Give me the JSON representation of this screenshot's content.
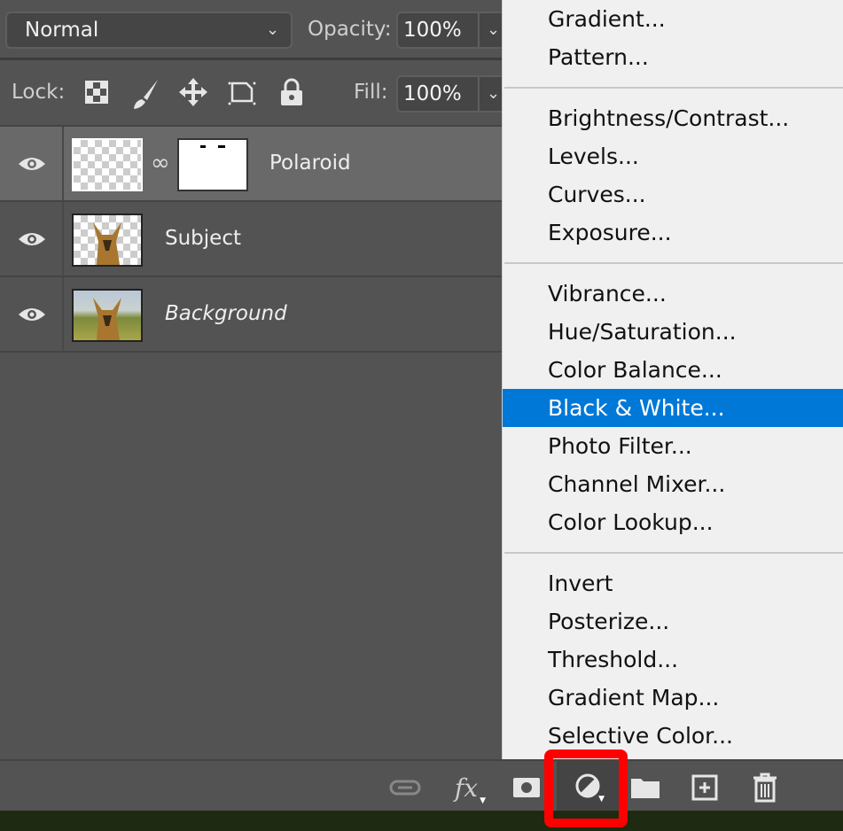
{
  "options": {
    "blend_mode": "Normal",
    "opacity_label": "Opacity:",
    "opacity_value": "100%",
    "lock_label": "Lock:",
    "fill_label": "Fill:",
    "fill_value": "100%",
    "lock_icons": [
      "lock-transparent-pixels-icon",
      "lock-image-pixels-icon",
      "lock-position-icon",
      "lock-artboard-icon",
      "lock-all-icon"
    ]
  },
  "layers": [
    {
      "name": "Polaroid",
      "selected": true,
      "has_mask": true
    },
    {
      "name": "Subject",
      "selected": false
    },
    {
      "name": "Background",
      "selected": false,
      "italic": true
    }
  ],
  "menu": {
    "groups": [
      [
        "Gradient...",
        "Pattern..."
      ],
      [
        "Brightness/Contrast...",
        "Levels...",
        "Curves...",
        "Exposure..."
      ],
      [
        "Vibrance...",
        "Hue/Saturation...",
        "Color Balance...",
        "Black & White...",
        "Photo Filter...",
        "Channel Mixer...",
        "Color Lookup..."
      ],
      [
        "Invert",
        "Posterize...",
        "Threshold...",
        "Gradient Map...",
        "Selective Color..."
      ]
    ],
    "highlighted": "Black & White...",
    "highlight_color": "#0078d7"
  },
  "bottom_bar": {
    "icons": [
      "link-layers-icon",
      "fx-icon",
      "add-mask-icon",
      "adjustment-layer-icon",
      "group-folder-icon",
      "new-layer-icon",
      "trash-icon"
    ],
    "fx_label": "fx",
    "callout_color": "#ff0000"
  }
}
